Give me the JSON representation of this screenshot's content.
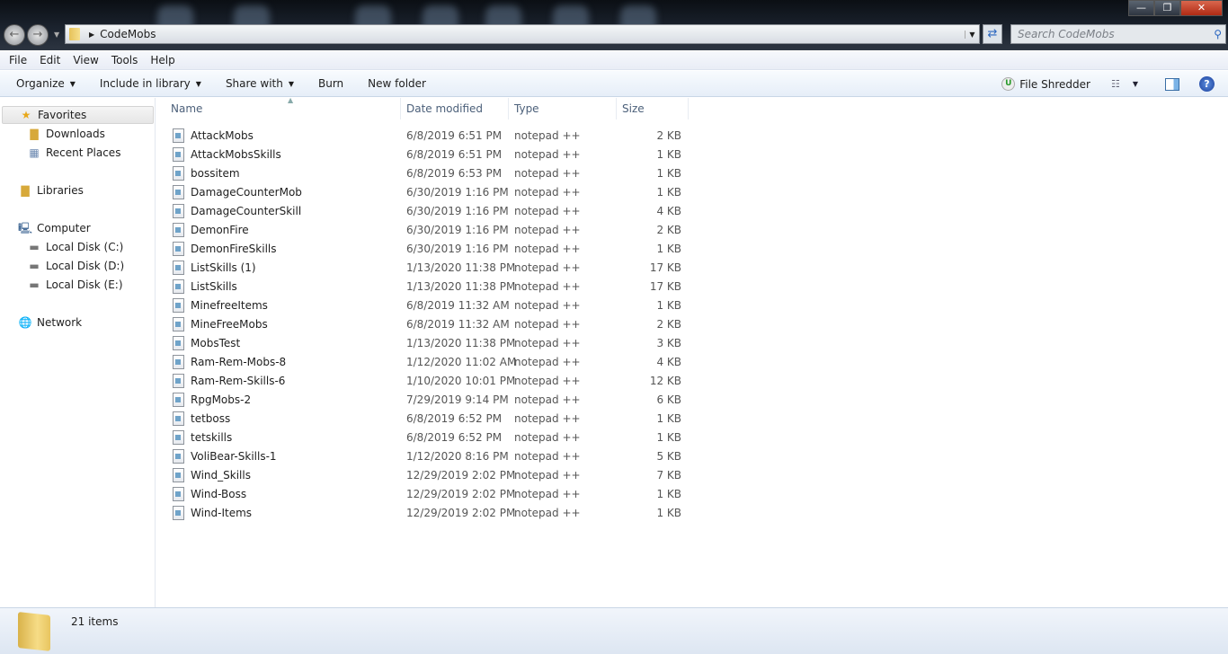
{
  "window": {
    "minimize": "—",
    "maximize": "❐",
    "close": "✕"
  },
  "address": {
    "path": "CodeMobs",
    "search_placeholder": "Search CodeMobs"
  },
  "menu": [
    "File",
    "Edit",
    "View",
    "Tools",
    "Help"
  ],
  "toolbar": {
    "organize": "Organize",
    "include": "Include in library",
    "share": "Share with",
    "burn": "Burn",
    "new_folder": "New folder",
    "file_shredder": "File Shredder"
  },
  "sidebar": {
    "favorites": "Favorites",
    "downloads": "Downloads",
    "recent": "Recent Places",
    "libraries": "Libraries",
    "computer": "Computer",
    "c": "Local Disk (C:)",
    "d": "Local Disk (D:)",
    "e": "Local Disk (E:)",
    "network": "Network"
  },
  "columns": {
    "name": "Name",
    "date": "Date modified",
    "type": "Type",
    "size": "Size"
  },
  "files": [
    {
      "name": "AttackMobs",
      "date": "6/8/2019 6:51 PM",
      "type": "notepad ++",
      "size": "2 KB"
    },
    {
      "name": "AttackMobsSkills",
      "date": "6/8/2019 6:51 PM",
      "type": "notepad ++",
      "size": "1 KB"
    },
    {
      "name": "bossitem",
      "date": "6/8/2019 6:53 PM",
      "type": "notepad ++",
      "size": "1 KB"
    },
    {
      "name": "DamageCounterMob",
      "date": "6/30/2019 1:16 PM",
      "type": "notepad ++",
      "size": "1 KB"
    },
    {
      "name": "DamageCounterSkill",
      "date": "6/30/2019 1:16 PM",
      "type": "notepad ++",
      "size": "4 KB"
    },
    {
      "name": "DemonFire",
      "date": "6/30/2019 1:16 PM",
      "type": "notepad ++",
      "size": "2 KB"
    },
    {
      "name": "DemonFireSkills",
      "date": "6/30/2019 1:16 PM",
      "type": "notepad ++",
      "size": "1 KB"
    },
    {
      "name": "ListSkills (1)",
      "date": "1/13/2020 11:38 PM",
      "type": "notepad ++",
      "size": "17 KB"
    },
    {
      "name": "ListSkills",
      "date": "1/13/2020 11:38 PM",
      "type": "notepad ++",
      "size": "17 KB"
    },
    {
      "name": "MinefreeItems",
      "date": "6/8/2019 11:32 AM",
      "type": "notepad ++",
      "size": "1 KB"
    },
    {
      "name": "MineFreeMobs",
      "date": "6/8/2019 11:32 AM",
      "type": "notepad ++",
      "size": "2 KB"
    },
    {
      "name": "MobsTest",
      "date": "1/13/2020 11:38 PM",
      "type": "notepad ++",
      "size": "3 KB"
    },
    {
      "name": "Ram-Rem-Mobs-8",
      "date": "1/12/2020 11:02 AM",
      "type": "notepad ++",
      "size": "4 KB"
    },
    {
      "name": "Ram-Rem-Skills-6",
      "date": "1/10/2020 10:01 PM",
      "type": "notepad ++",
      "size": "12 KB"
    },
    {
      "name": "RpgMobs-2",
      "date": "7/29/2019 9:14 PM",
      "type": "notepad ++",
      "size": "6 KB"
    },
    {
      "name": "tetboss",
      "date": "6/8/2019 6:52 PM",
      "type": "notepad ++",
      "size": "1 KB"
    },
    {
      "name": "tetskills",
      "date": "6/8/2019 6:52 PM",
      "type": "notepad ++",
      "size": "1 KB"
    },
    {
      "name": "VoliBear-Skills-1",
      "date": "1/12/2020 8:16 PM",
      "type": "notepad ++",
      "size": "5 KB"
    },
    {
      "name": "Wind_Skills",
      "date": "12/29/2019 2:02 PM",
      "type": "notepad ++",
      "size": "7 KB"
    },
    {
      "name": "Wind-Boss",
      "date": "12/29/2019 2:02 PM",
      "type": "notepad ++",
      "size": "1 KB"
    },
    {
      "name": "Wind-Items",
      "date": "12/29/2019 2:02 PM",
      "type": "notepad ++",
      "size": "1 KB"
    }
  ],
  "status": {
    "count": "21 items"
  }
}
